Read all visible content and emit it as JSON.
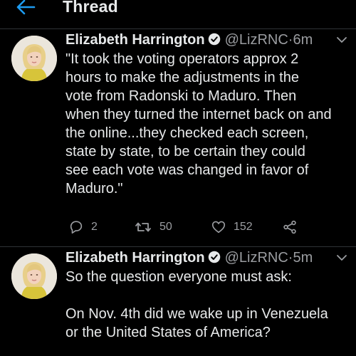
{
  "header": {
    "title": "Thread"
  },
  "tweets": [
    {
      "name": "Elizabeth Harrington",
      "handle": "@LizRNC",
      "separator": "·",
      "time": "6m",
      "text": "\"It took the voting operators approx 2\nhours to make the adjustments in the\nvote from Radonski to Maduro. Then\nwhen they turned the internet back on and\nthe online...they checked each screen,\nstate by state, to be certain they could\nsee each vote was changed in favor of\nMaduro.\"",
      "replies": "2",
      "retweets": "50",
      "likes": "152"
    },
    {
      "name": "Elizabeth Harrington",
      "handle": "@LizRNC",
      "separator": "·",
      "time": "5m",
      "text": "So the question everyone must ask:\n\nOn Nov. 4th did we wake up in Venezuela\nor the United States of America?"
    }
  ],
  "colors": {
    "background": "#000000",
    "text": "#e7e9ea",
    "muted": "#9b9da1",
    "accent": "#1d9bf0",
    "divider": "#2f3336"
  },
  "icons": {
    "back": "arrow-left-icon",
    "verified": "verified-badge-icon",
    "caret": "chevron-down-icon",
    "reply": "reply-icon",
    "retweet": "retweet-icon",
    "like": "heart-icon",
    "share": "share-icon"
  }
}
